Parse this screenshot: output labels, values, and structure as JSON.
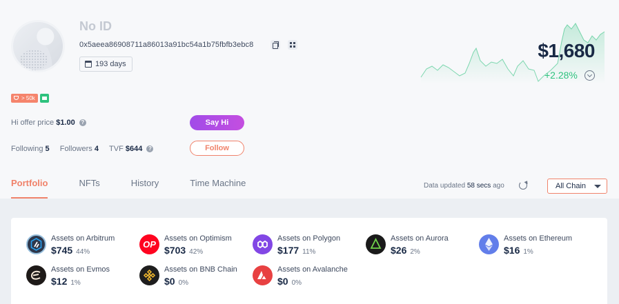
{
  "profile": {
    "name": "No ID",
    "address": "0x5aeea86908711a86013a91bc54a1b75fbfb3ebc8",
    "days": "193 days",
    "rank_tag": "> 50k"
  },
  "balance": {
    "value": "$1,680",
    "change": "+2.28%"
  },
  "colors": {
    "accent": "#f0826a",
    "positive": "#2ec27e",
    "say_hi": "#b04de6"
  },
  "stats": {
    "offer_label": "Hi offer price",
    "offer_value": "$1.00",
    "following_label": "Following",
    "following_value": "5",
    "followers_label": "Followers",
    "followers_value": "4",
    "tvf_label": "TVF",
    "tvf_value": "$644"
  },
  "buttons": {
    "say_hi": "Say Hi",
    "follow": "Follow"
  },
  "tabs": [
    "Portfolio",
    "NFTs",
    "History",
    "Time Machine"
  ],
  "data_updated": {
    "prefix": "Data updated",
    "value": "58 secs",
    "suffix": "ago"
  },
  "chain_filter": "All Chain",
  "assets": [
    {
      "label": "Assets on Arbitrum",
      "value": "$745",
      "pct": "44%",
      "icon": "arbitrum-icon",
      "color": "#2d374b"
    },
    {
      "label": "Assets on Optimism",
      "value": "$703",
      "pct": "42%",
      "icon": "optimism-icon",
      "color": "#ff0420",
      "glyph": "OP"
    },
    {
      "label": "Assets on Polygon",
      "value": "$177",
      "pct": "11%",
      "icon": "polygon-icon",
      "color": "#8247e5"
    },
    {
      "label": "Assets on Aurora",
      "value": "$26",
      "pct": "2%",
      "icon": "aurora-icon",
      "color": "#1a1a1a"
    },
    {
      "label": "Assets on Ethereum",
      "value": "$16",
      "pct": "1%",
      "icon": "ethereum-icon",
      "color": "#627eea"
    },
    {
      "label": "Assets on Evmos",
      "value": "$12",
      "pct": "1%",
      "icon": "evmos-icon",
      "color": "#1e1a18"
    },
    {
      "label": "Assets on BNB Chain",
      "value": "$0",
      "pct": "0%",
      "icon": "bnb-icon",
      "color": "#1e1e1e"
    },
    {
      "label": "Assets on Avalanche",
      "value": "$0",
      "pct": "0%",
      "icon": "avalanche-icon",
      "color": "#e84142"
    }
  ]
}
